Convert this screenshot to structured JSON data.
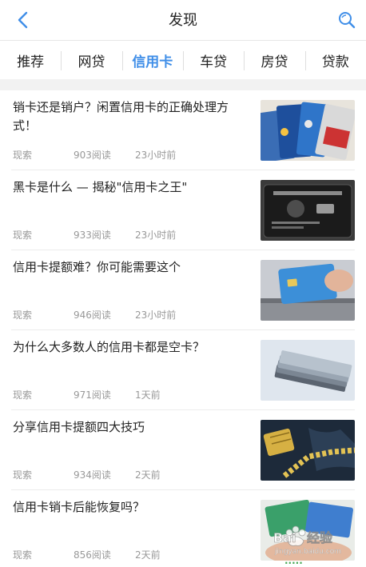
{
  "header": {
    "title": "发现",
    "back_icon": "chevron-left-icon",
    "search_icon": "search-icon",
    "accent": "#3f8ee8"
  },
  "tabs": [
    {
      "label": "推荐",
      "active": false
    },
    {
      "label": "网贷",
      "active": false
    },
    {
      "label": "信用卡",
      "active": true
    },
    {
      "label": "车贷",
      "active": false
    },
    {
      "label": "房贷",
      "active": false
    },
    {
      "label": "贷款",
      "active": false
    }
  ],
  "articles": [
    {
      "title": "销卡还是销户？闲置信用卡的正确处理方式！",
      "source": "现索",
      "reads": "903阅读",
      "time": "23小时前",
      "thumb": "stacked-credit-cards"
    },
    {
      "title": "黑卡是什么 — 揭秘\"信用卡之王\"",
      "source": "现索",
      "reads": "933阅读",
      "time": "23小时前",
      "thumb": "black-card"
    },
    {
      "title": "信用卡提额难？你可能需要这个",
      "source": "现索",
      "reads": "946阅读",
      "time": "23小时前",
      "thumb": "card-in-hand"
    },
    {
      "title": "为什么大多数人的信用卡都是空卡？",
      "source": "现索",
      "reads": "971阅读",
      "time": "1天前",
      "thumb": "card-stack"
    },
    {
      "title": "分享信用卡提额四大技巧",
      "source": "现索",
      "reads": "934阅读",
      "time": "2天前",
      "thumb": "chip-map"
    },
    {
      "title": "信用卡销卡后能恢复吗？",
      "source": "现索",
      "reads": "856阅读",
      "time": "2天前",
      "thumb": "cards-in-hand"
    }
  ],
  "watermark": {
    "brand": "Baidu经验",
    "url": "jingyan.baidu.com"
  }
}
